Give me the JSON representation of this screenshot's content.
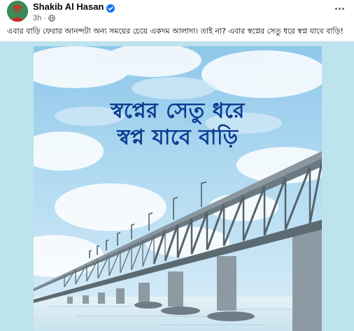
{
  "post": {
    "author": "Shakib Al Hasan",
    "timestamp": "3h",
    "separator": "·",
    "privacy_icon": "globe-icon",
    "verified_icon": "verified-badge-icon",
    "caption": "এবার বাড়ি ফেরার আনন্দটা অন্য সময়ের চেয়ে একদম আলাদা। তাই না? এবার স্বপ্নের সেতু ধরে স্বপ্ন যাবে বাড়ি!"
  },
  "artwork": {
    "title_line1": "স্বপ্নের সেতু ধরে",
    "title_line2": "স্বপ্ন যাবে বাড়ি"
  },
  "colors": {
    "verified": "#1877f2",
    "title_text": "#0b3d91",
    "sky": "#a9d6f0",
    "outer_backdrop": "#bde3ec",
    "bridge": "#5c6a72"
  }
}
